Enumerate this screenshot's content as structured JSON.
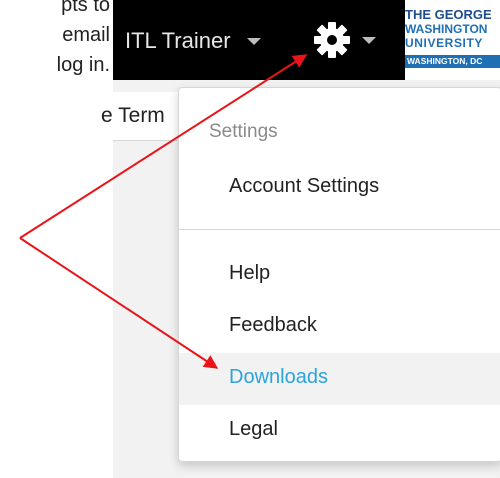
{
  "intro_text": {
    "line1": "pts to",
    "line2": "email",
    "line3": "log in."
  },
  "header": {
    "user_name": "ITL Trainer",
    "gear_icon": "gear-icon",
    "caret_icon": "caret-down-icon",
    "logo": {
      "line1": "THE GEORGE",
      "line2": "WASHINGTON",
      "line3": "UNIVERSITY",
      "line4": "WASHINGTON, DC"
    }
  },
  "subnav": {
    "partial_label": "e Term"
  },
  "settings_menu": {
    "header": "Settings",
    "items": [
      {
        "label": "Account Settings"
      },
      {
        "label": "Help"
      },
      {
        "label": "Feedback"
      },
      {
        "label": "Downloads",
        "active": true
      },
      {
        "label": "Legal"
      }
    ]
  },
  "colors": {
    "topbar": "#000000",
    "active_item": "#2ba3dd",
    "annotation_arrow": "#e8141a"
  }
}
